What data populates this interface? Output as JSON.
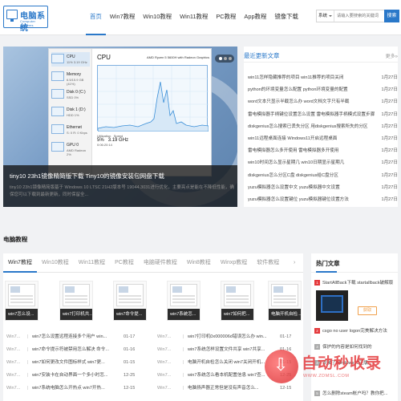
{
  "logo": {
    "name": "电脑系统",
    "sub": "Computer Systems"
  },
  "nav": [
    "首页",
    "Win7教程",
    "Win10教程",
    "Win11教程",
    "PC教程",
    "App教程",
    "镜像下载"
  ],
  "search": {
    "scope": "系统",
    "placeholder": "请输入要搜索的关键词",
    "button": "搜索"
  },
  "banner": {
    "title": "tiny10 23h1镜像精简版下载 Tiny10的镜像安装包网盘下载",
    "desc": "tiny10 23h1镜像精简版基于 Windows 10 LTSC 21H2版本号 19044.3031进行优化，主要亮点是能在不降低性能，确保您可以下载到最新更新，同时保留全...",
    "screen": {
      "cpu_title": "CPU",
      "cpu_name": "AMD Ryzen 5 5600H with Radeon Graphics",
      "side_items": [
        {
          "t": "CPU",
          "v": "11% 3.19 GHz"
        },
        {
          "t": "Memory",
          "v": "6.5/15.9 GB (41%)"
        },
        {
          "t": "Disk 0 (C:)",
          "v": "SSD 0%"
        },
        {
          "t": "Disk 1 (D:)",
          "v": "HDD 1%"
        },
        {
          "t": "Ethernet",
          "v": "S: 0 R: 0 Kbps"
        },
        {
          "t": "GPU 0",
          "v": "AMD Radeon 2%"
        }
      ],
      "util_label": "Utilization",
      "util_value": "5%",
      "speed_label": "Speed",
      "speed_value": "3.19 GHz",
      "uptime_value": "0:06:20:14"
    }
  },
  "recent": {
    "title": "最近更新文章",
    "more": "更多»",
    "items": [
      {
        "t": "win11怎样隐藏推荐的项目 win11推荐的项目关闭",
        "d": "1月27日"
      },
      {
        "t": "python的环境变量怎么配置 python环境变量的配置",
        "d": "1月27日"
      },
      {
        "t": "word文本只显示半截怎么办 word文档文字只有半截",
        "d": "1月27日"
      },
      {
        "t": "雷电模拟器手柄键位设置怎么设置 雷电模拟器手柄模式设置步骤",
        "d": "1月27日"
      },
      {
        "t": "diskgenius怎么搜索已丢失分区 用diskgenius搜索所失的分区",
        "d": "1月27日"
      },
      {
        "t": "win11远程桌面连接 Windows11开启远程桌面",
        "d": "1月27日"
      },
      {
        "t": "雷电模拟器怎么多开使用 雷电模拟器多开使用",
        "d": "1月27日"
      },
      {
        "t": "win10时间怎么显示星期几 win10日期显示星期几",
        "d": "1月27日"
      },
      {
        "t": "diskgenius怎么分区C盘 diskgenius给C盘分区",
        "d": "1月27日"
      },
      {
        "t": "yuzu模拟器怎么设置中文 yuzu模拟器中文设置",
        "d": "1月27日"
      },
      {
        "t": "yuzu模拟器怎么设置键位 yuzu模拟器键位设置方法",
        "d": "1月27日"
      }
    ]
  },
  "section": {
    "title": "电脑教程"
  },
  "tabs": [
    "Win7教程",
    "Win10教程",
    "Win11教程",
    "PC教程",
    "电脑硬件教程",
    "Win8教程",
    "Winxp教程",
    "软件教程"
  ],
  "tabs_more": "›",
  "thumbs": [
    "win7怎么设...",
    "win7打印机共...",
    "win7命令提...",
    "win7系统怎...",
    "win7如何把...",
    "电脑开机自检..."
  ],
  "rows": [
    {
      "c": "Win7...",
      "t": "win7怎么设置远程连接多个用户 win...",
      "d": "01-17",
      "c2": "Win7...",
      "t2": "win7打印机0x000006d错误怎么办 win...",
      "d2": "01-17"
    },
    {
      "c": "Win7...",
      "t": "win7命令提示符被禁用怎么解决 命令...",
      "d": "01-16",
      "c2": "Win7...",
      "t2": "win7系统怎样设置文件共享 win7共享...",
      "d2": "01-16"
    },
    {
      "c": "Win7...",
      "t": "win7如何更改文件图标样式 win7更...",
      "d": "01-15",
      "c2": "Win7...",
      "t2": "电脑开机自检怎么关闭 win7关闭开机...",
      "d2": "01-15"
    },
    {
      "c": "Win7...",
      "t": "win7安装卡在自动界面一个多小时怎...",
      "d": "12-25",
      "c2": "Win7...",
      "t2": "win7系统怎么看本机配置信息 win7查...",
      "d2": "12-25"
    },
    {
      "c": "Win7...",
      "t": "win7系统电脑怎么开热点 win7开热...",
      "d": "12-15",
      "c2": "Win7...",
      "t2": "电脑扬声器正常但是没有声音怎么...",
      "d2": "12-15"
    }
  ],
  "hot": {
    "title": "热门文章",
    "items": [
      {
        "n": "1",
        "t": "StartAllBack下载 startallback破解版"
      },
      {
        "n": "2",
        "t": "csgo no user logon完美解决方法"
      },
      {
        "n": "3",
        "t": "保护的内容是如何找到的"
      },
      {
        "n": "4",
        "t": "安装了Windows10正版..."
      },
      {
        "n": "5",
        "t": "怎么删除steam帐户吗？教你把..."
      }
    ],
    "feature_btn": "获取"
  },
  "watermark": {
    "main": "自动秒收录",
    "sub": "WWW.ZDMSL.COM"
  },
  "colors": {
    "accent": "#2a78c9",
    "hot": "#e4393c"
  }
}
